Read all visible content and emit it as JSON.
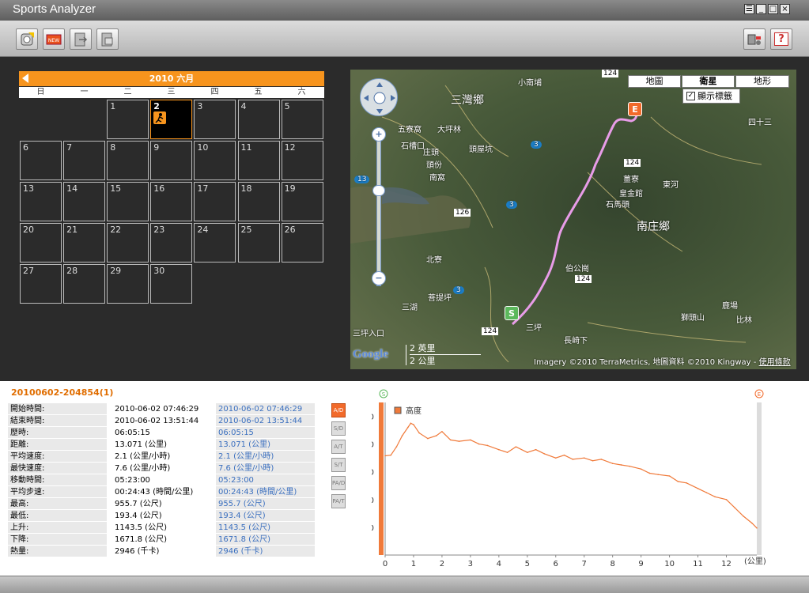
{
  "app": {
    "title": "Sports Analyzer",
    "window_buttons": [
      "☰",
      "_",
      "□",
      "×"
    ]
  },
  "toolbar": {
    "buttons": [
      "import-device",
      "new-session",
      "export",
      "sync"
    ],
    "right_buttons": [
      "device-settings",
      "help"
    ],
    "help_label": "?"
  },
  "calendar": {
    "header": "2010 六月",
    "weekdays": [
      "日",
      "一",
      "二",
      "三",
      "四",
      "五",
      "六"
    ],
    "first_weekday": 2,
    "days_in_month": 30,
    "selected_day": 2,
    "days": [
      "1",
      "2",
      "3",
      "4",
      "5",
      "6",
      "7",
      "8",
      "9",
      "10",
      "11",
      "12",
      "13",
      "14",
      "15",
      "16",
      "17",
      "18",
      "19",
      "20",
      "21",
      "22",
      "23",
      "24",
      "25",
      "26",
      "27",
      "28",
      "29",
      "30"
    ]
  },
  "map": {
    "types": [
      "地圖",
      "衛星",
      "地形"
    ],
    "active_type": "衛星",
    "show_labels_checkbox": "顯示標籤",
    "show_labels_checked": true,
    "places": [
      "三灣鄉",
      "南庄鄉",
      "五寮窩",
      "大坪林",
      "石槽口",
      "頭屋坑",
      "庄頭",
      "頭份",
      "南窩",
      "田美",
      "南埔",
      "屋連塘",
      "崎坑",
      "公館",
      "山坑",
      "牛角",
      "北寮",
      "三湖",
      "菩提坪",
      "三坪入口",
      "三坪",
      "長崎下",
      "伯公崗",
      "皇金館",
      "石馬頭",
      "薑寮",
      "東河",
      "鹿湖",
      "獅頭山",
      "頭屋鄉",
      "四十三",
      "新竹縣",
      "苗栗縣",
      "比林",
      "鹿場",
      "小南埔"
    ],
    "road_shields": [
      "124",
      "3",
      "13",
      "126",
      "124",
      "124",
      "124",
      "124",
      "3",
      "3"
    ],
    "zoom_in": "+",
    "zoom_out": "−",
    "scale_imperial": "2 英里",
    "scale_metric": "2 公里",
    "attribution": "Imagery ©2010 TerraMetrics, 地圖資料 ©2010 Kingway - ",
    "terms_link": "使用條款",
    "logo": "Google",
    "marker_start": "S",
    "marker_end": "E"
  },
  "session": {
    "title": "20100602-204854(1)",
    "rows": [
      {
        "label": "開始時間:",
        "value": "2010-06-02 07:46:29",
        "compare": "2010-06-02 07:46:29"
      },
      {
        "label": "結束時間:",
        "value": "2010-06-02 13:51:44",
        "compare": "2010-06-02 13:51:44"
      },
      {
        "label": "歷時:",
        "value": "06:05:15",
        "compare": "06:05:15"
      },
      {
        "label": "距離:",
        "value": "13.071 (公里)",
        "compare": "13.071 (公里)"
      },
      {
        "label": "平均速度:",
        "value": "2.1 (公里/小時)",
        "compare": "2.1 (公里/小時)"
      },
      {
        "label": "最快速度:",
        "value": "7.6 (公里/小時)",
        "compare": "7.6 (公里/小時)"
      },
      {
        "label": "移動時間:",
        "value": "05:23:00",
        "compare": "05:23:00"
      },
      {
        "label": "平均步速:",
        "value": "00:24:43 (時間/公里)",
        "compare": "00:24:43 (時間/公里)"
      },
      {
        "label": "最高:",
        "value": "955.7 (公尺)",
        "compare": "955.7 (公尺)"
      },
      {
        "label": "最低:",
        "value": "193.4 (公尺)",
        "compare": "193.4 (公尺)"
      },
      {
        "label": "上升:",
        "value": "1143.5 (公尺)",
        "compare": "1143.5 (公尺)"
      },
      {
        "label": "下降:",
        "value": "1671.8 (公尺)",
        "compare": "1671.8 (公尺)"
      },
      {
        "label": "熱量:",
        "value": "2946 (千卡)",
        "compare": "2946 (千卡)"
      }
    ]
  },
  "profile_tools": [
    "A/D",
    "S/D",
    "A/T",
    "S/T",
    "PA/D",
    "PA/T"
  ],
  "profile_tools_active": "A/D",
  "chart_data": {
    "type": "line",
    "title": "",
    "legend": "高度",
    "legend_position": "top-left",
    "xlabel": "(公里)",
    "ylabel": "",
    "xlim": [
      0,
      13.071
    ],
    "ylim": [
      0,
      1100
    ],
    "x_ticks": [
      0,
      1,
      2,
      3,
      4,
      5,
      6,
      7,
      8,
      9,
      10,
      11,
      12
    ],
    "y_ticks": [
      200,
      400,
      600,
      800,
      1000
    ],
    "grid": false,
    "color": "#f07a3a",
    "start_marker": "S",
    "end_marker": "E",
    "series": [
      {
        "x": [
          0,
          0.2,
          0.4,
          0.6,
          0.8,
          0.9,
          1.0,
          1.2,
          1.5,
          1.8,
          2.0,
          2.3,
          2.6,
          3.0,
          3.3,
          3.6,
          4.0,
          4.3,
          4.6,
          5.0,
          5.3,
          5.6,
          6.0,
          6.3,
          6.6,
          7.0,
          7.3,
          7.6,
          8.0,
          8.3,
          8.6,
          9.0,
          9.3,
          9.6,
          10.0,
          10.3,
          10.6,
          11.0,
          11.3,
          11.6,
          12.0,
          12.3,
          12.6,
          12.9,
          13.071
        ],
        "y": [
          715,
          720,
          780,
          860,
          920,
          950,
          940,
          880,
          840,
          860,
          890,
          830,
          820,
          830,
          800,
          790,
          760,
          740,
          780,
          740,
          760,
          730,
          700,
          720,
          690,
          700,
          680,
          690,
          660,
          650,
          640,
          620,
          590,
          580,
          570,
          530,
          520,
          480,
          450,
          420,
          400,
          340,
          280,
          230,
          195
        ]
      }
    ]
  }
}
